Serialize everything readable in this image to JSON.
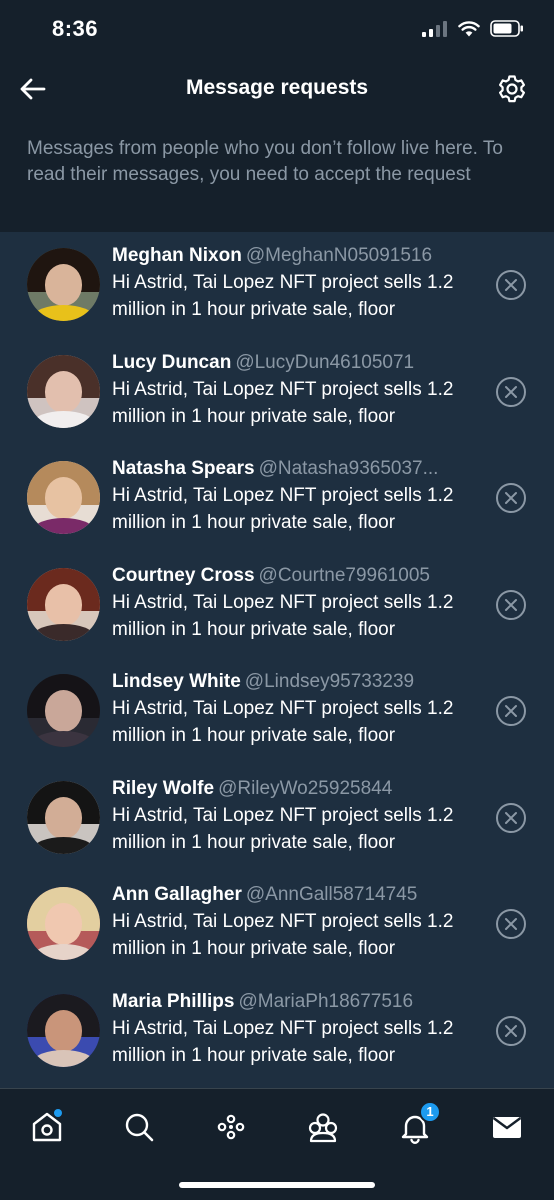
{
  "status_bar": {
    "time": "8:36"
  },
  "header": {
    "title": "Message requests"
  },
  "info": {
    "text": "Messages from people who you don’t follow live here. To read their messages, you need to accept the request"
  },
  "requests": [
    {
      "name": "Meghan Nixon",
      "handle": "@MeghanN05091516",
      "preview": "Hi Astrid, Tai Lopez NFT project sells 1.2 million in 1 hour private sale, floor",
      "avatar_colors": {
        "bg": "#6e7a66",
        "hair": "#1f1510",
        "face": "#d9b49a",
        "body": "#e8c11a"
      }
    },
    {
      "name": "Lucy Duncan",
      "handle": "@LucyDun46105071",
      "preview": "Hi Astrid, Tai Lopez NFT project sells 1.2 million in 1 hour private sale, floor",
      "avatar_colors": {
        "bg": "#cfc3c0",
        "hair": "#4a3029",
        "face": "#e2bfae",
        "body": "#f1eeee"
      }
    },
    {
      "name": "Natasha Spears",
      "handle": "@Natasha9365037...",
      "preview": "Hi Astrid, Tai Lopez NFT project sells 1.2 million in 1 hour private sale, floor",
      "avatar_colors": {
        "bg": "#e7ddd4",
        "hair": "#b58a5c",
        "face": "#e7c2a2",
        "body": "#7a2a68"
      }
    },
    {
      "name": "Courtney Cross",
      "handle": "@Courtne79961005",
      "preview": "Hi Astrid, Tai Lopez NFT project sells 1.2 million in 1 hour private sale, floor",
      "avatar_colors": {
        "bg": "#d8c7bb",
        "hair": "#6b2a1e",
        "face": "#e8c0a8",
        "body": "#3a2a2a"
      }
    },
    {
      "name": "Lindsey White",
      "handle": "@Lindsey95733239",
      "preview": "Hi Astrid, Tai Lopez NFT project sells 1.2 million in 1 hour private sale, floor",
      "avatar_colors": {
        "bg": "#2a2a33",
        "hair": "#151317",
        "face": "#c9a799",
        "body": "#3b3440"
      }
    },
    {
      "name": "Riley Wolfe",
      "handle": "@RileyWo25925844",
      "preview": "Hi Astrid, Tai Lopez NFT project sells 1.2 million in 1 hour private sale, floor",
      "avatar_colors": {
        "bg": "#c9c4c0",
        "hair": "#141414",
        "face": "#d2ad96",
        "body": "#1b1b1b"
      }
    },
    {
      "name": "Ann Gallagher",
      "handle": "@AnnGall58714745",
      "preview": "Hi Astrid, Tai Lopez NFT project sells 1.2 million in 1 hour private sale, floor",
      "avatar_colors": {
        "bg": "#b55a5a",
        "hair": "#e3cfa0",
        "face": "#f0c8b0",
        "body": "#e6d3c9"
      }
    },
    {
      "name": "Maria Phillips",
      "handle": "@MariaPh18677516",
      "preview": "Hi Astrid, Tai Lopez NFT project sells 1.2 million in 1 hour private sale, floor",
      "avatar_colors": {
        "bg": "#3b4bb0",
        "hair": "#1b1a1f",
        "face": "#c9957a",
        "body": "#d9c4b8"
      }
    }
  ],
  "bottom_nav": {
    "notifications_badge": "1",
    "icons": [
      "home-icon",
      "search-icon",
      "spaces-icon",
      "communities-icon",
      "notifications-icon",
      "messages-icon"
    ]
  },
  "colors": {
    "background": "#15202b",
    "list_background": "#1e2f40",
    "secondary_text": "#8b98a5",
    "accent": "#1d9bf0"
  }
}
